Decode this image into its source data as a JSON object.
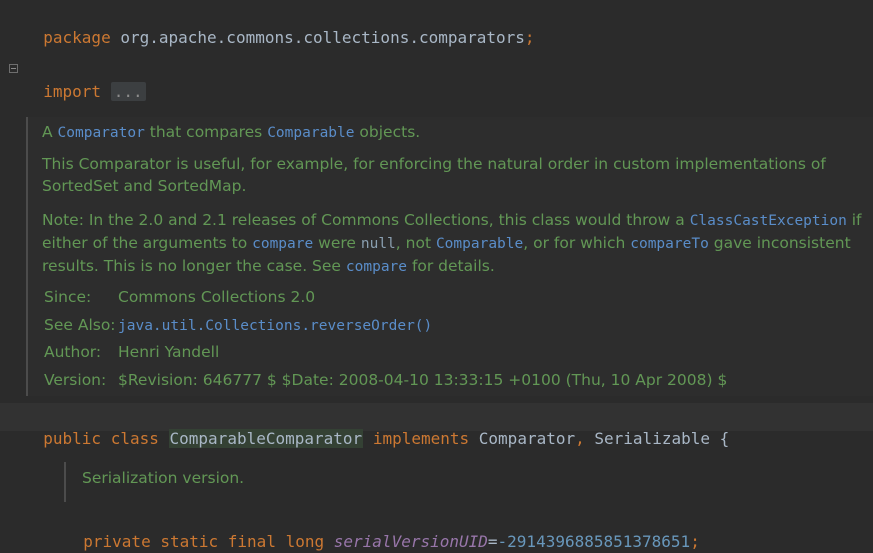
{
  "code": {
    "package_kw": "package",
    "package_name": "org.apache.commons.collections.comparators",
    "semicolon": ";",
    "import_kw": "import",
    "import_folded": "...",
    "class_line": {
      "public": "public",
      "class": "class",
      "name": "ComparableComparator",
      "implements": "implements",
      "iface1": "Comparator",
      "comma": ",",
      "iface2": "Serializable",
      "brace": "{"
    },
    "field_line": {
      "private": "private",
      "static": "static",
      "final": "final",
      "long": "long",
      "name": "serialVersionUID",
      "eq": "=",
      "value": "-2914396885851378651",
      "semicolon": ";"
    }
  },
  "javadoc": {
    "p1": {
      "a": "A ",
      "comparator": "Comparator",
      "mid": " that compares ",
      "comparable": "Comparable",
      "end": " objects."
    },
    "p2": "This Comparator is useful, for example, for enforcing the natural order in custom implementations of SortedSet and SortedMap.",
    "p3": {
      "t1": "Note: In the 2.0 and 2.1 releases of Commons Collections, this class would throw a ",
      "cce": "ClassCastException",
      "t2": " if either of the arguments to ",
      "compare1": "compare",
      "t3": " were ",
      "null": "null",
      "t4": ", not ",
      "comparable": "Comparable",
      "t5": ", or for which ",
      "compareTo": "compareTo",
      "t6": " gave inconsistent results. This is no longer the case. See ",
      "compare2": "compare",
      "t7": " for details."
    },
    "tags": {
      "since_label": "Since:",
      "since_value": "Commons Collections 2.0",
      "seealso_label": "See Also:",
      "seealso_value": "java.util.Collections.reverseOrder()",
      "author_label": "Author:",
      "author_value": "Henri Yandell",
      "version_label": "Version:",
      "version_value": "$Revision: 646777 $ $Date: 2008-04-10 13:33:15 +0100 (Thu, 10 Apr 2008) $"
    }
  },
  "field_doc": "Serialization version.",
  "colors": {
    "background": "#2b2b2b",
    "keyword": "#cc7832",
    "doc_text": "#629755",
    "doc_link": "#5a8dc9",
    "number": "#6897bb",
    "field": "#9876aa"
  }
}
